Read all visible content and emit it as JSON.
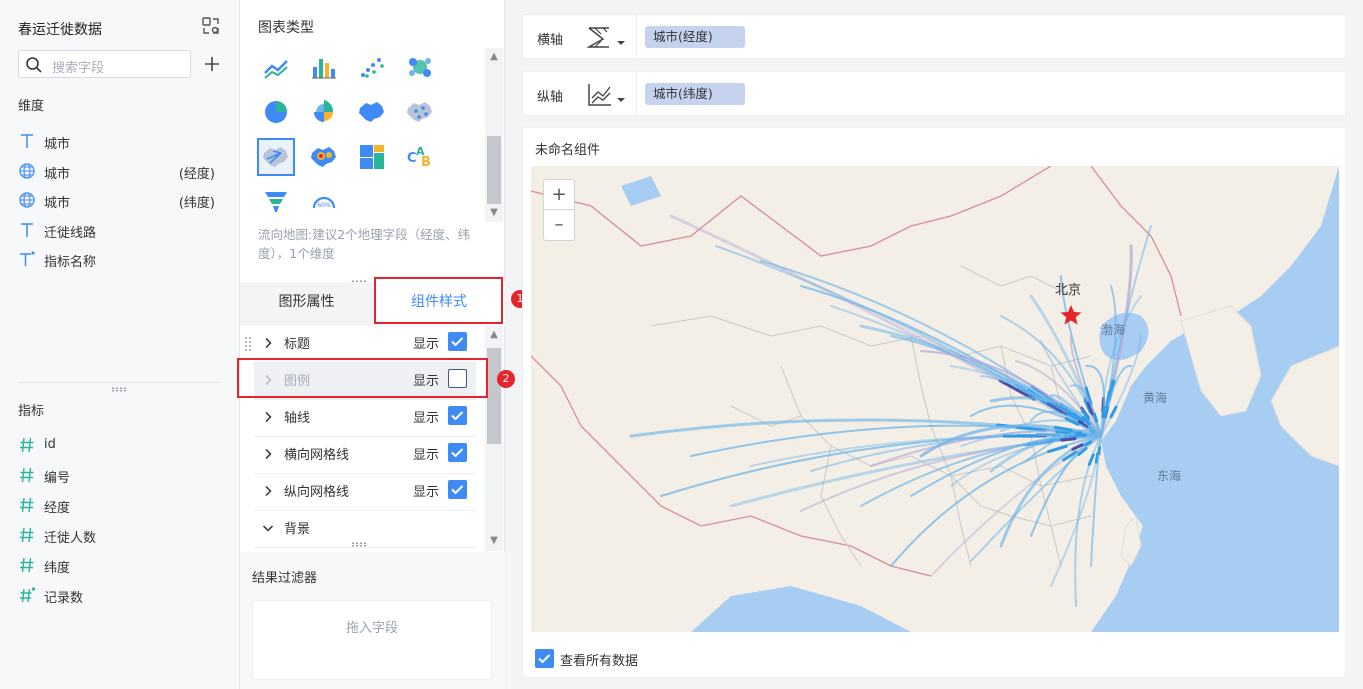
{
  "left": {
    "dataset_title": "春运迁徙数据",
    "search_placeholder": "搜索字段",
    "dimensions_label": "维度",
    "dimensions": [
      {
        "name": "城市",
        "suffix": "",
        "icon": "text-field-icon"
      },
      {
        "name": "城市",
        "suffix": "(经度)",
        "icon": "globe-icon"
      },
      {
        "name": "城市",
        "suffix": "(纬度)",
        "icon": "globe-icon"
      },
      {
        "name": "迁徙线路",
        "suffix": "",
        "icon": "text-field-icon"
      },
      {
        "name": "指标名称",
        "suffix": "",
        "icon": "text-calculated-field-icon"
      }
    ],
    "measures_label": "指标",
    "measures": [
      {
        "name": "id",
        "icon": "number-field-icon"
      },
      {
        "name": "编号",
        "icon": "number-field-icon"
      },
      {
        "name": "经度",
        "icon": "number-field-icon"
      },
      {
        "name": "迁徙人数",
        "icon": "number-field-icon"
      },
      {
        "name": "纬度",
        "icon": "number-field-icon"
      },
      {
        "name": "记录数",
        "icon": "number-calculated-field-icon"
      }
    ]
  },
  "middle": {
    "chart_types_title": "图表类型",
    "chart_types": [
      "line-chart-icon",
      "bar-chart-icon",
      "scatter-chart-icon",
      "bubble-chart-icon",
      "pie-chart-icon",
      "rose-chart-icon",
      "region-map-icon",
      "point-map-icon",
      "flow-map-icon",
      "heat-map-icon",
      "treemap-icon",
      "word-cloud-icon",
      "funnel-chart-icon",
      "gauge-chart-icon"
    ],
    "selected_chart_type": "flow-map-icon",
    "gauge_icon_text": "60%",
    "word_cloud_icon_text": "CAB",
    "chart_hint": "流向地图:建议2个地理字段（经度、纬度），1个维度",
    "tab_shape_props": "图形属性",
    "tab_component_style": "组件样式",
    "active_tab": "组件样式",
    "style_items": [
      {
        "name": "标题",
        "show_label": "显示",
        "checked": true,
        "expanded": false,
        "dimmed": false
      },
      {
        "name": "图例",
        "show_label": "显示",
        "checked": false,
        "expanded": false,
        "dimmed": true
      },
      {
        "name": "轴线",
        "show_label": "显示",
        "checked": true,
        "expanded": false,
        "dimmed": false
      },
      {
        "name": "横向网格线",
        "show_label": "显示",
        "checked": true,
        "expanded": false,
        "dimmed": false
      },
      {
        "name": "纵向网格线",
        "show_label": "显示",
        "checked": true,
        "expanded": false,
        "dimmed": false
      },
      {
        "name": "背景",
        "show_label": "",
        "checked": null,
        "expanded": true,
        "dimmed": false
      }
    ],
    "filter_title": "结果过滤器",
    "filter_drop_hint": "拖入字段",
    "annotations": [
      "1",
      "2"
    ]
  },
  "right": {
    "x_axis_label": "横轴",
    "x_axis_field": "城市(经度)",
    "y_axis_label": "纵轴",
    "y_axis_field": "城市(纬度)",
    "component_title": "未命名组件",
    "map_labels": {
      "capital": "北京",
      "sea1": "渤海",
      "sea2": "黄海",
      "sea3": "东海"
    },
    "zoom_in": "+",
    "zoom_out": "–",
    "see_all_label": "查看所有数据",
    "see_all_checked": true
  },
  "colors": {
    "accent": "#3e8bf6",
    "annotation_red": "#e5252a",
    "field_pill": "#c5d3ef",
    "flow_line": "#6fb6ea",
    "sea": "#a7cdf2",
    "land": "#f4efe6"
  }
}
